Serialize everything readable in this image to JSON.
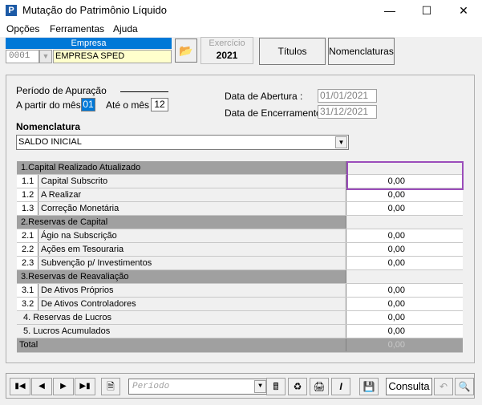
{
  "window": {
    "title": "Mutação do Patrimônio Líquido",
    "minimize": "—",
    "maximize": "☐",
    "close": "✕"
  },
  "menu": [
    "Opções",
    "Ferramentas",
    "Ajuda"
  ],
  "empresa": {
    "label": "Empresa",
    "code": "0001",
    "name": "EMPRESA SPED"
  },
  "exercicio": {
    "label": "Exercício",
    "year": "2021"
  },
  "buttons": {
    "titulos": "Títulos",
    "nomenclaturas": "Nomenclaturas"
  },
  "periodo": {
    "title": "Período de Apuração",
    "from_label": "A partir do mês",
    "from_value": "01",
    "to_label": "Até o mês",
    "to_value": "12"
  },
  "dates": {
    "abertura_label": "Data de Abertura :",
    "abertura_value": "01/01/2021",
    "encerramento_label": "Data de Encerramento :",
    "encerramento_value": "31/12/2021"
  },
  "nomenclatura": {
    "label": "Nomenclatura",
    "selected": "SALDO INICIAL"
  },
  "grid": {
    "rows": [
      {
        "type": "head",
        "label": "1.Capital Realizado Atualizado",
        "value": ""
      },
      {
        "type": "item",
        "code": "1.1",
        "label": "Capital Subscrito",
        "value": "0,00"
      },
      {
        "type": "item",
        "code": "1.2",
        "label": "A Realizar",
        "value": "0,00"
      },
      {
        "type": "item",
        "code": "1.3",
        "label": "Correção Monetária",
        "value": "0,00"
      },
      {
        "type": "head",
        "label": "2.Reservas de Capital",
        "value": ""
      },
      {
        "type": "item",
        "code": "2.1",
        "label": "Ágio na Subscrição",
        "value": "0,00"
      },
      {
        "type": "item",
        "code": "2.2",
        "label": "Ações em Tesouraria",
        "value": "0,00"
      },
      {
        "type": "item",
        "code": "2.3",
        "label": "Subvenção p/ Investimentos",
        "value": "0,00"
      },
      {
        "type": "head",
        "label": "3.Reservas de Reavaliação",
        "value": ""
      },
      {
        "type": "item",
        "code": "3.1",
        "label": "De Ativos Próprios",
        "value": "0,00"
      },
      {
        "type": "item",
        "code": "3.2",
        "label": "De Ativos Controladores",
        "value": "0,00"
      },
      {
        "type": "full",
        "label": "4. Reservas de Lucros",
        "value": "0,00"
      },
      {
        "type": "full",
        "label": "5. Lucros Acumulados",
        "value": "0,00"
      },
      {
        "type": "total",
        "label": "Total",
        "value": "0,00"
      }
    ]
  },
  "bottom": {
    "periodo_placeholder": "Período",
    "consulta": "Consulta"
  },
  "colors": {
    "accent": "#0078d7",
    "highlight": "#9b4dbb",
    "company_bg": "#ffffcc"
  }
}
